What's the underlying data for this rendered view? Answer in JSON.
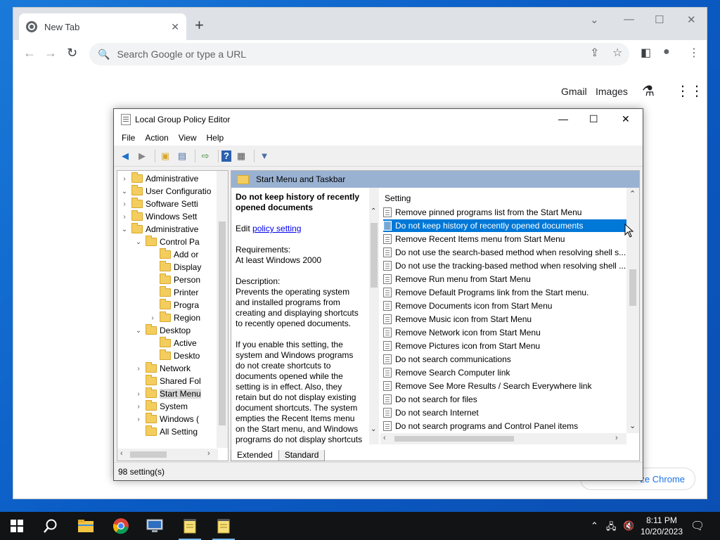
{
  "chrome": {
    "tab_title": "New Tab",
    "tab_close": "✕",
    "new_tab": "+",
    "omnibox_placeholder": "Search Google or type a URL",
    "links": {
      "gmail": "Gmail",
      "images": "Images"
    },
    "customize_label": "ze Chrome"
  },
  "gpe": {
    "title": "Local Group Policy Editor",
    "menu": [
      "File",
      "Action",
      "View",
      "Help"
    ],
    "tree": [
      {
        "label": "Administrative",
        "level": 1,
        "expander": "›"
      },
      {
        "label": "User Configuratio",
        "level": 0,
        "expander": "⌄"
      },
      {
        "label": "Software Setti",
        "level": 1,
        "expander": "›"
      },
      {
        "label": "Windows Sett",
        "level": 1,
        "expander": "›"
      },
      {
        "label": "Administrative",
        "level": 1,
        "expander": "⌄"
      },
      {
        "label": "Control Pa",
        "level": 2,
        "expander": "⌄"
      },
      {
        "label": "Add or",
        "level": 3,
        "expander": ""
      },
      {
        "label": "Display",
        "level": 3,
        "expander": ""
      },
      {
        "label": "Person",
        "level": 3,
        "expander": ""
      },
      {
        "label": "Printer",
        "level": 3,
        "expander": ""
      },
      {
        "label": "Progra",
        "level": 3,
        "expander": ""
      },
      {
        "label": "Region",
        "level": 3,
        "expander": "›"
      },
      {
        "label": "Desktop",
        "level": 2,
        "expander": "⌄"
      },
      {
        "label": "Active",
        "level": 3,
        "expander": ""
      },
      {
        "label": "Deskto",
        "level": 3,
        "expander": ""
      },
      {
        "label": "Network",
        "level": 2,
        "expander": "›"
      },
      {
        "label": "Shared Fol",
        "level": 2,
        "expander": ""
      },
      {
        "label": "Start Menu",
        "level": 2,
        "expander": "›"
      },
      {
        "label": "System",
        "level": 2,
        "expander": "›"
      },
      {
        "label": "Windows (",
        "level": 2,
        "expander": "›"
      },
      {
        "label": "All Setting",
        "level": 2,
        "expander": ""
      }
    ],
    "path_title": "Start Menu and Taskbar",
    "description": {
      "title": "Do not keep history of recently opened documents",
      "edit_prefix": "Edit ",
      "edit_link": "policy setting",
      "requirements_label": "Requirements:",
      "requirements_value": "At least Windows 2000",
      "description_label": "Description:",
      "description_text": "Prevents the operating system and installed programs from creating and displaying shortcuts to recently opened documents.",
      "enable_text": "If you enable this setting, the system and Windows programs do not create shortcuts to documents opened while the setting is in effect. Also, they retain but do not display existing document shortcuts. The system empties the Recent Items menu on the Start menu, and Windows programs do not display shortcuts"
    },
    "list_header": "Setting",
    "settings": [
      "Remove pinned programs list from the Start Menu",
      "Do not keep history of recently opened documents",
      "Remove Recent Items menu from Start Menu",
      "Do not use the search-based method when resolving shell s...",
      "Do not use the tracking-based method when resolving shell ...",
      "Remove Run menu from Start Menu",
      "Remove Default Programs link from the Start menu.",
      "Remove Documents icon from Start Menu",
      "Remove Music icon from Start Menu",
      "Remove Network icon from Start Menu",
      "Remove Pictures icon from Start Menu",
      "Do not search communications",
      "Remove Search Computer link",
      "Remove See More Results / Search Everywhere link",
      "Do not search for files",
      "Do not search Internet",
      "Do not search programs and Control Panel items"
    ],
    "tabs": [
      "Extended",
      "Standard"
    ],
    "status": "98 setting(s)"
  },
  "taskbar": {
    "time": "8:11 PM",
    "date": "10/20/2023"
  },
  "colors": {
    "selection": "#0078d7",
    "path_bar": "#9ab2d2",
    "taskbar": "#111314"
  }
}
